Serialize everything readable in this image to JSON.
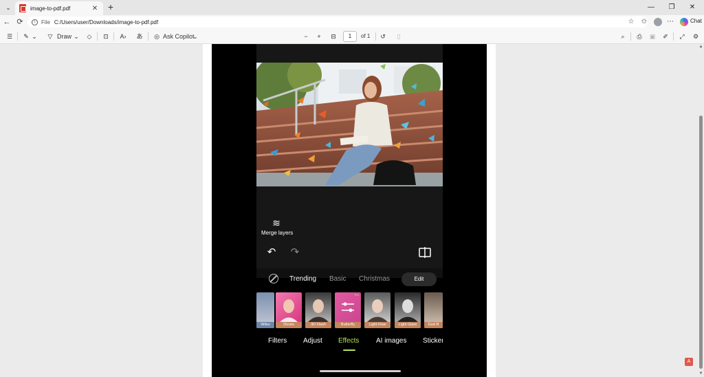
{
  "browser": {
    "tab_title": "image-to-pdf.pdf",
    "address_prefix": "File",
    "url": "C:/Users/user/Downloads/image-to-pdf.pdf",
    "chat_label": "Chat"
  },
  "pdf_toolbar": {
    "draw_label": "Draw",
    "ask_copilot_label": "Ask Copilot",
    "page_current": "1",
    "page_total_label": "of 1"
  },
  "editor": {
    "merge_layers_label": "Merge layers",
    "categories": [
      "Trending",
      "Basic",
      "Christmas"
    ],
    "edit_button_label": "Edit",
    "effects": [
      {
        "label": "Wiles"
      },
      {
        "label": "Doves"
      },
      {
        "label": "3D Flash"
      },
      {
        "label": "Butterfly",
        "pro": "Pro"
      },
      {
        "label": "Light Flow"
      },
      {
        "label": "Light Glare"
      },
      {
        "label": "God R"
      }
    ],
    "bottom_tabs": [
      "Filters",
      "Adjust",
      "Effects",
      "AI images",
      "Sticker"
    ],
    "active_tab": "Effects",
    "accent_color": "#b8e35a"
  }
}
